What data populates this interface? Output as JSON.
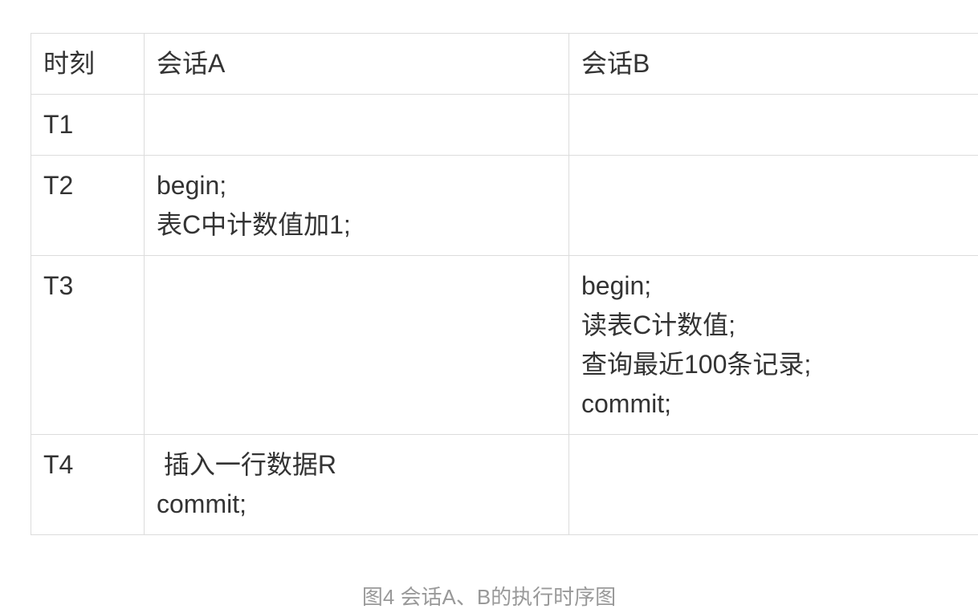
{
  "table": {
    "headers": {
      "time": "时刻",
      "session_a": "会话A",
      "session_b": "会话B"
    },
    "rows": [
      {
        "time": "T1",
        "session_a": [],
        "session_b": []
      },
      {
        "time": "T2",
        "session_a": [
          "begin;",
          "表C中计数值加1;"
        ],
        "session_b": []
      },
      {
        "time": "T3",
        "session_a": [],
        "session_b": [
          "begin;",
          "读表C计数值;",
          "查询最近100条记录;",
          "commit;"
        ]
      },
      {
        "time": "T4",
        "session_a": [
          " 插入一行数据R",
          "commit;"
        ],
        "session_b": []
      }
    ]
  },
  "caption": "图4 会话A、B的执行时序图"
}
